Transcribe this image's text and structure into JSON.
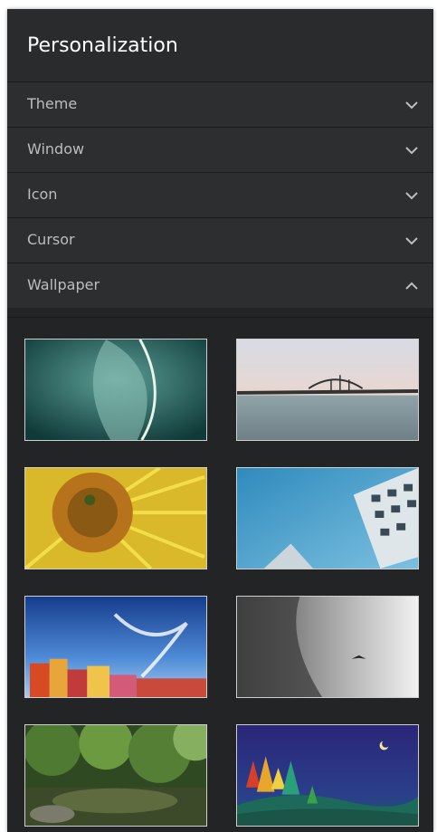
{
  "panel": {
    "title": "Personalization"
  },
  "sections": [
    {
      "label": "Theme",
      "expanded": false,
      "icon": "chevron-down-icon"
    },
    {
      "label": "Window",
      "expanded": false,
      "icon": "chevron-down-icon"
    },
    {
      "label": "Icon",
      "expanded": false,
      "icon": "chevron-down-icon"
    },
    {
      "label": "Cursor",
      "expanded": false,
      "icon": "chevron-down-icon"
    },
    {
      "label": "Wallpaper",
      "expanded": true,
      "icon": "chevron-up-icon"
    }
  ],
  "wallpapers": [
    {
      "name": "teal-leaf"
    },
    {
      "name": "bridge-over-sea"
    },
    {
      "name": "sunflower"
    },
    {
      "name": "building-blue-sky"
    },
    {
      "name": "colorful-city-sky"
    },
    {
      "name": "foggy-cliff"
    },
    {
      "name": "forest-pond"
    },
    {
      "name": "night-trees-moon"
    }
  ],
  "colors": {
    "panel_bg": "#232425",
    "row_bg": "#2d2e2f",
    "title_text": "#ffffff",
    "row_text": "#bdbdbd"
  }
}
